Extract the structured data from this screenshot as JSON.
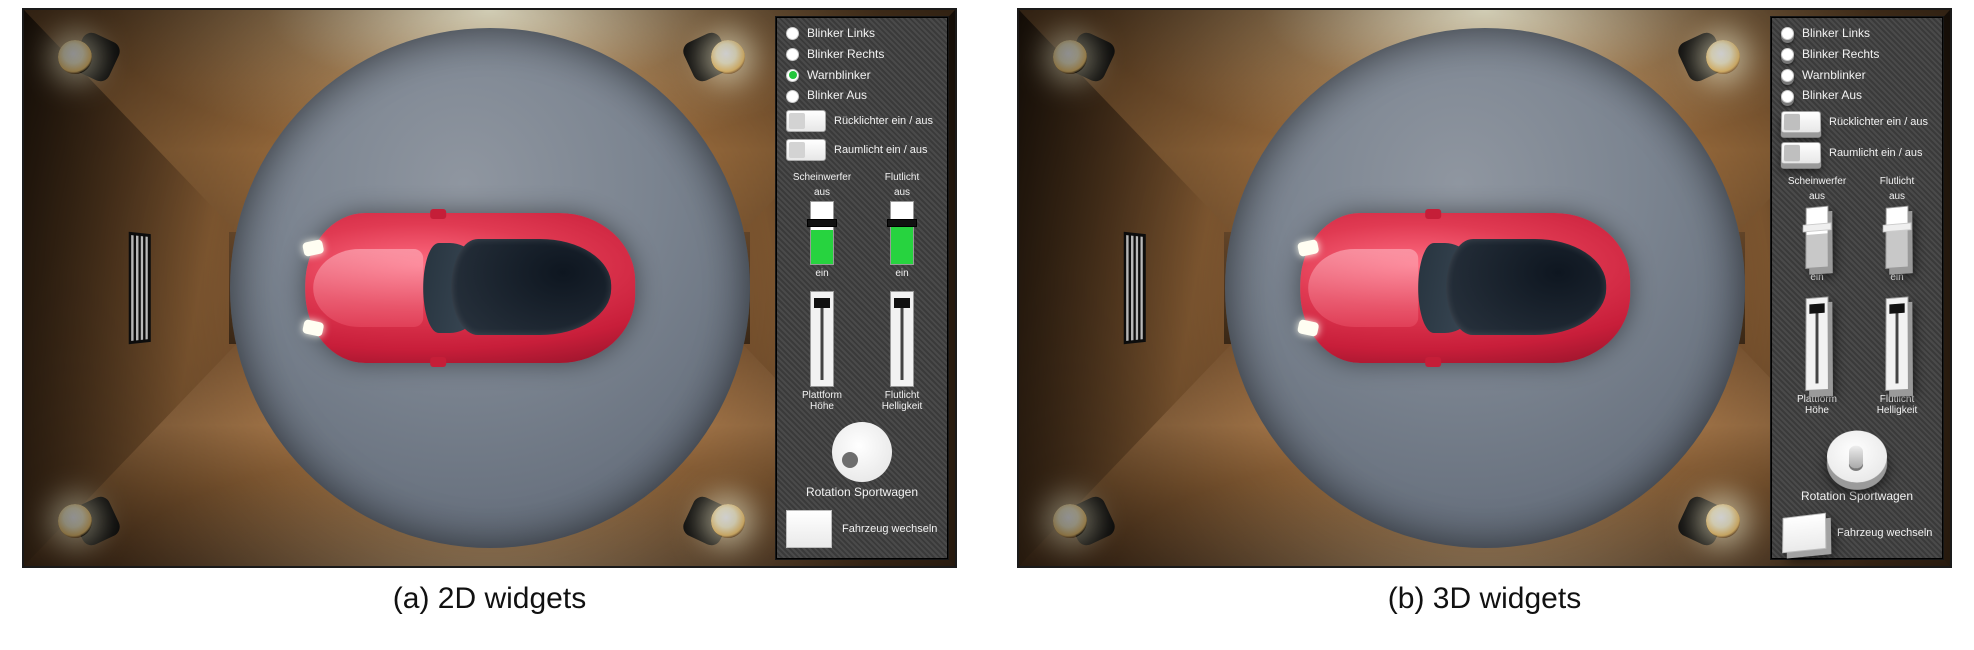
{
  "captions": {
    "a": "(a) 2D widgets",
    "b": "(b) 3D widgets"
  },
  "panel": {
    "radios": [
      {
        "label": "Blinker Links",
        "on": false
      },
      {
        "label": "Blinker Rechts",
        "on": false
      },
      {
        "label": "Warnblinker",
        "on": true
      },
      {
        "label": "Blinker Aus",
        "on": false
      }
    ],
    "toggles": [
      {
        "label": "Rücklichter ein / aus"
      },
      {
        "label": "Raumlicht ein / aus"
      }
    ],
    "sliders_onoff": [
      {
        "top": "Scheinwerfer",
        "off": "aus",
        "on": "ein",
        "fill": 55
      },
      {
        "top": "Flutlicht",
        "off": "aus",
        "on": "ein",
        "fill": 60
      }
    ],
    "sliders_value": [
      {
        "label": "Plattform Höhe"
      },
      {
        "label": "Flutlicht Helligkeit"
      }
    ],
    "dial_label": "Rotation Sportwagen",
    "button_label": "Fahrzeug wechseln"
  }
}
